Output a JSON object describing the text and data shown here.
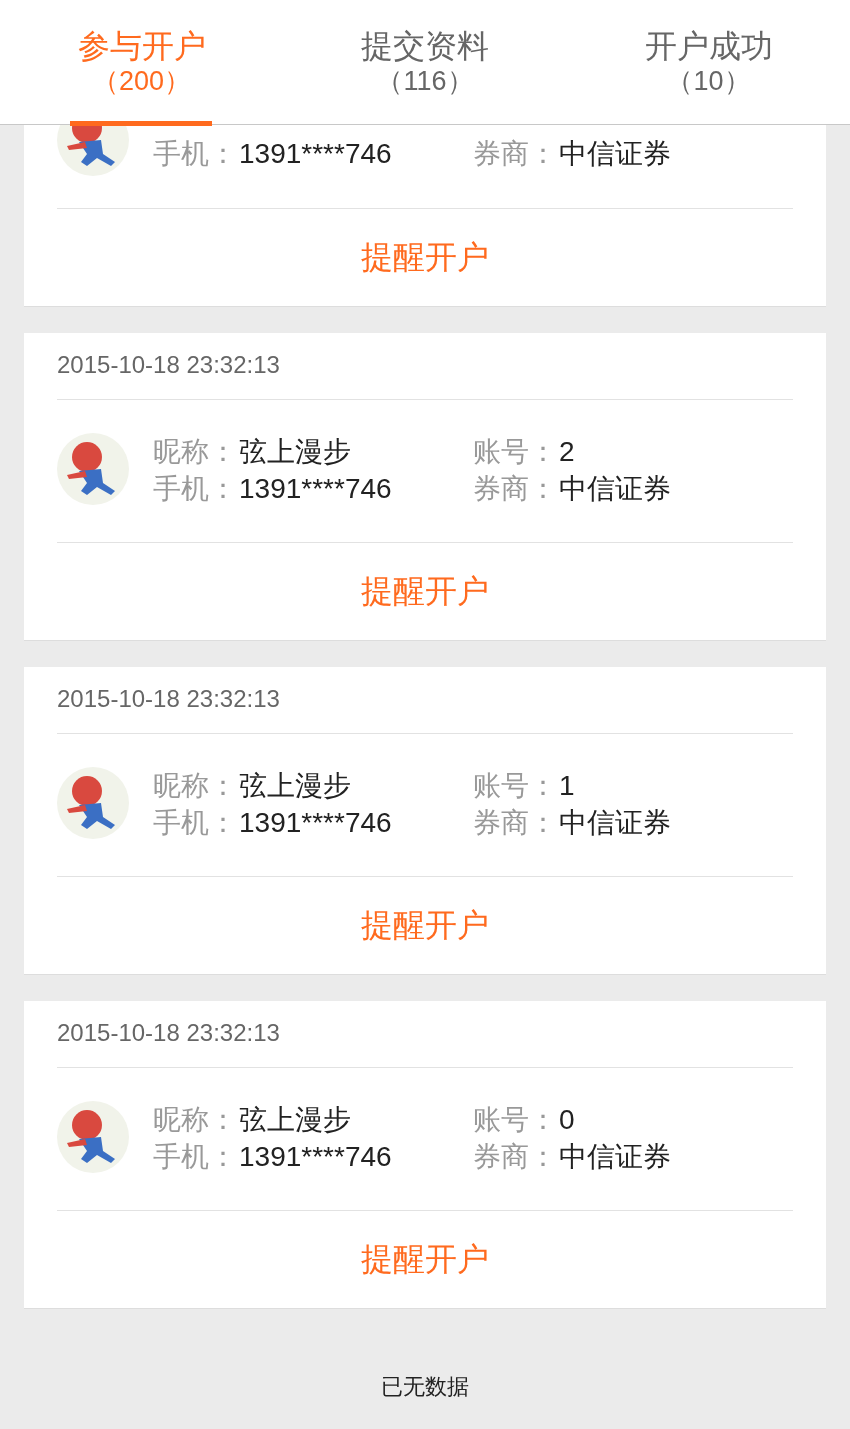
{
  "tabs": [
    {
      "title": "参与开户",
      "count": "（200）",
      "selected": true
    },
    {
      "title": "提交资料",
      "count": "（116）",
      "selected": false
    },
    {
      "title": "开户成功",
      "count": "（10）",
      "selected": false
    }
  ],
  "records": [
    {
      "fields": [
        {
          "label": "手机：",
          "value": "1391****746"
        },
        {
          "label": "券商：",
          "value": "中信证券"
        }
      ],
      "action": "提醒开户"
    },
    {
      "datetime": "2015-10-18 23:32:13",
      "fields": [
        {
          "label": "昵称：",
          "value": "弦上漫步"
        },
        {
          "label": "账号：",
          "value": "2"
        },
        {
          "label": "手机：",
          "value": "1391****746"
        },
        {
          "label": "券商：",
          "value": "中信证券"
        }
      ],
      "action": "提醒开户"
    },
    {
      "datetime": "2015-10-18 23:32:13",
      "fields": [
        {
          "label": "昵称：",
          "value": "弦上漫步"
        },
        {
          "label": "账号：",
          "value": "1"
        },
        {
          "label": "手机：",
          "value": "1391****746"
        },
        {
          "label": "券商：",
          "value": "中信证券"
        }
      ],
      "action": "提醒开户"
    },
    {
      "datetime": "2015-10-18 23:32:13",
      "fields": [
        {
          "label": "昵称：",
          "value": "弦上漫步"
        },
        {
          "label": "账号：",
          "value": "0"
        },
        {
          "label": "手机：",
          "value": "1391****746"
        },
        {
          "label": "券商：",
          "value": "中信证券"
        }
      ],
      "action": "提醒开户"
    }
  ],
  "footer": "已无数据"
}
